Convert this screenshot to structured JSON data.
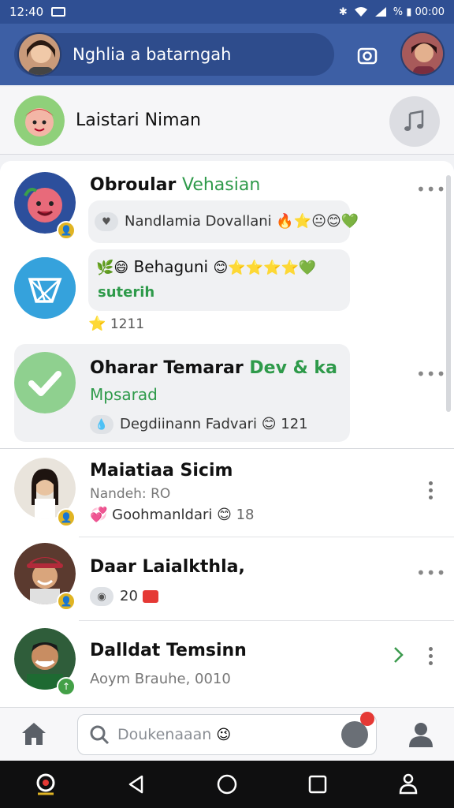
{
  "status_bar": {
    "time": "12:40",
    "right_text": "% ▮ 00:00"
  },
  "header": {
    "title": "Nghlia a batarngah"
  },
  "profile": {
    "name": "Laistari Niman"
  },
  "conversations": [
    {
      "name": "Obroular",
      "name_accent": "Vehasian",
      "preview": "Nandlamia Dovallani",
      "more": "•••"
    },
    {
      "name": "Behaguni",
      "name_accent": "suterih",
      "count": "1211"
    },
    {
      "name": "Oharar Temarar",
      "name_accent": "Dev & ka",
      "sub": "Mpsarad",
      "preview": "Degdiinann Fadvari",
      "count": "121",
      "more": "•••"
    },
    {
      "name": "Maiatiaa Sicim",
      "sub": "Nandeh: RO",
      "preview": "Goohmanldari",
      "count": "18"
    },
    {
      "name": "Daar Laialkthla,",
      "count": "20",
      "more": "•••"
    },
    {
      "name": "Dalldat Temsinn",
      "sub": "Aoym Brauhe, 0010"
    }
  ],
  "bottom_search": {
    "placeholder": "Doukenaaan",
    "badge": ""
  },
  "colors": {
    "header": "#3d5fa5",
    "accent_green": "#2e9a4a",
    "badge_gold": "#e0b423",
    "badge_red": "#e53935"
  }
}
